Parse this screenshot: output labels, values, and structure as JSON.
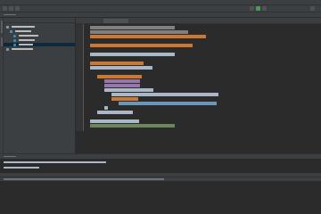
{
  "menu": [],
  "editor": {
    "tabs": []
  },
  "project": {
    "tree": []
  },
  "code_lines": [],
  "console_lines": [],
  "status_text": ""
}
